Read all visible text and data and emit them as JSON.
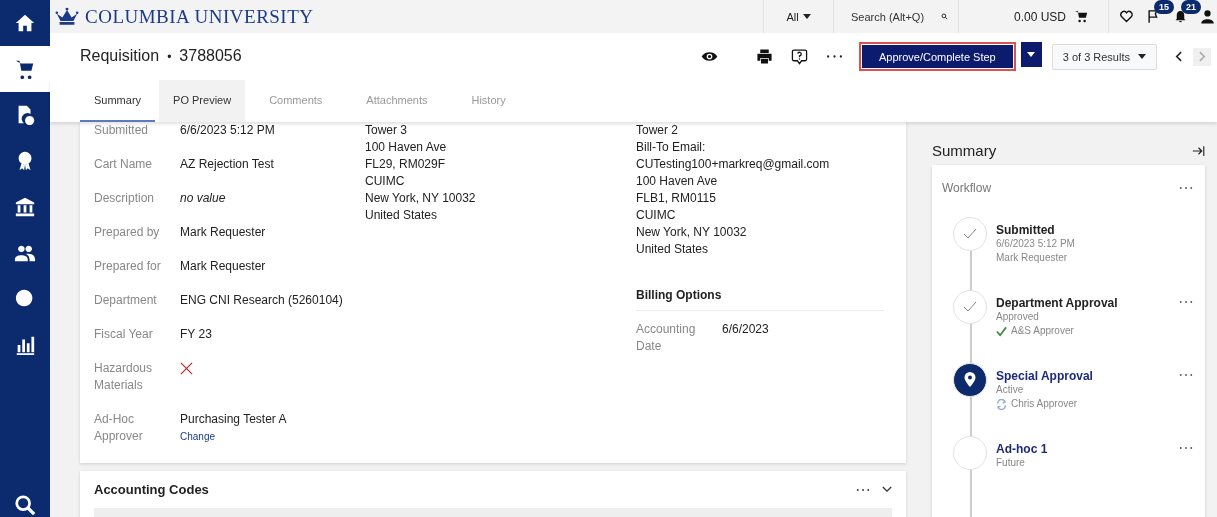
{
  "sidebar": {
    "items": [
      {
        "selected": false
      },
      {
        "selected": true
      },
      {
        "selected": false
      },
      {
        "selected": false
      },
      {
        "selected": false
      },
      {
        "selected": false
      },
      {
        "selected": false
      },
      {
        "selected": false
      }
    ]
  },
  "topbar": {
    "logo": "COLUMBIA UNIVERSITY",
    "scope": "All",
    "search": {
      "placeholder": "Search (Alt+Q)"
    },
    "cart_total": "0.00 USD",
    "flag_count": "15",
    "notification_count": "21"
  },
  "page_header": {
    "title": "Requisition",
    "separator": "•",
    "number": "3788056",
    "primary_action": {
      "label": "Approve/Complete Step",
      "focused": true
    },
    "results": "3 of 3 Results",
    "next_disabled": true,
    "prev_disabled": false
  },
  "tabs": [
    {
      "label": "Summary",
      "selected": true,
      "highlighted": false,
      "disabled": false
    },
    {
      "label": "PO Preview",
      "selected": false,
      "highlighted": true,
      "disabled": false
    },
    {
      "label": "Comments",
      "selected": false,
      "highlighted": false,
      "disabled": true
    },
    {
      "label": "Attachments",
      "selected": false,
      "highlighted": false,
      "disabled": true
    },
    {
      "label": "History",
      "selected": false,
      "highlighted": false,
      "disabled": true
    }
  ],
  "general": {
    "fields": [
      {
        "label": "Submitted",
        "kind": "text",
        "value": "6/6/2023 5:12 PM"
      },
      {
        "label": "Cart Name",
        "kind": "text",
        "value": "AZ Rejection Test"
      },
      {
        "label": "Description",
        "kind": "empty",
        "value": "no value"
      },
      {
        "label": "Prepared by",
        "kind": "text",
        "value": "Mark Requester"
      },
      {
        "label": "Prepared for",
        "kind": "text",
        "value": "Mark Requester"
      },
      {
        "label": "Department",
        "kind": "text",
        "value": "ENG CNI Research (5260104)"
      },
      {
        "label": "Fiscal Year",
        "kind": "text",
        "value": "FY 23"
      },
      {
        "label": "Hazardous Materials",
        "kind": "flag",
        "on": false
      },
      {
        "label": "Ad-Hoc Approver",
        "kind": "text",
        "value": "Purchasing Tester A",
        "link": "Change"
      }
    ],
    "ship_to": [
      "Tower 3",
      "100 Haven Ave",
      "FL29, RM029F",
      "CUIMC",
      "New York, NY 10032",
      "United States"
    ],
    "bill_to": [
      "Tower 2",
      "Bill-To Email:",
      "CUTesting100+markreq@gmail.com",
      "100 Haven Ave",
      "FLB1, RM0115",
      "CUIMC",
      "New York, NY 10032",
      "United States"
    ],
    "billing_options": {
      "title": "Billing Options",
      "fields": [
        {
          "label": "Accounting Date",
          "value": "6/6/2023"
        }
      ]
    }
  },
  "accounting_codes": {
    "title": "Accounting Codes"
  },
  "summary_panel": {
    "title": "Summary",
    "workflow": {
      "title": "Workflow",
      "steps": [
        {
          "title": "Submitted",
          "completed": true,
          "active": false,
          "details": [
            "6/6/2023 5:12 PM",
            "Mark Requester"
          ],
          "menu": false
        },
        {
          "title": "Department Approval",
          "completed": true,
          "active": false,
          "details": [
            "Approved"
          ],
          "approver": {
            "name": "A&S Approver",
            "approved": true
          },
          "menu": true
        },
        {
          "title": "Special Approval",
          "completed": false,
          "active": true,
          "details": [
            "Active"
          ],
          "approver": {
            "name": "Chris Approver",
            "approved": false
          },
          "menu": true
        },
        {
          "title": "Ad-hoc 1",
          "completed": false,
          "active": false,
          "details": [
            "Future"
          ],
          "menu": true
        }
      ]
    }
  }
}
